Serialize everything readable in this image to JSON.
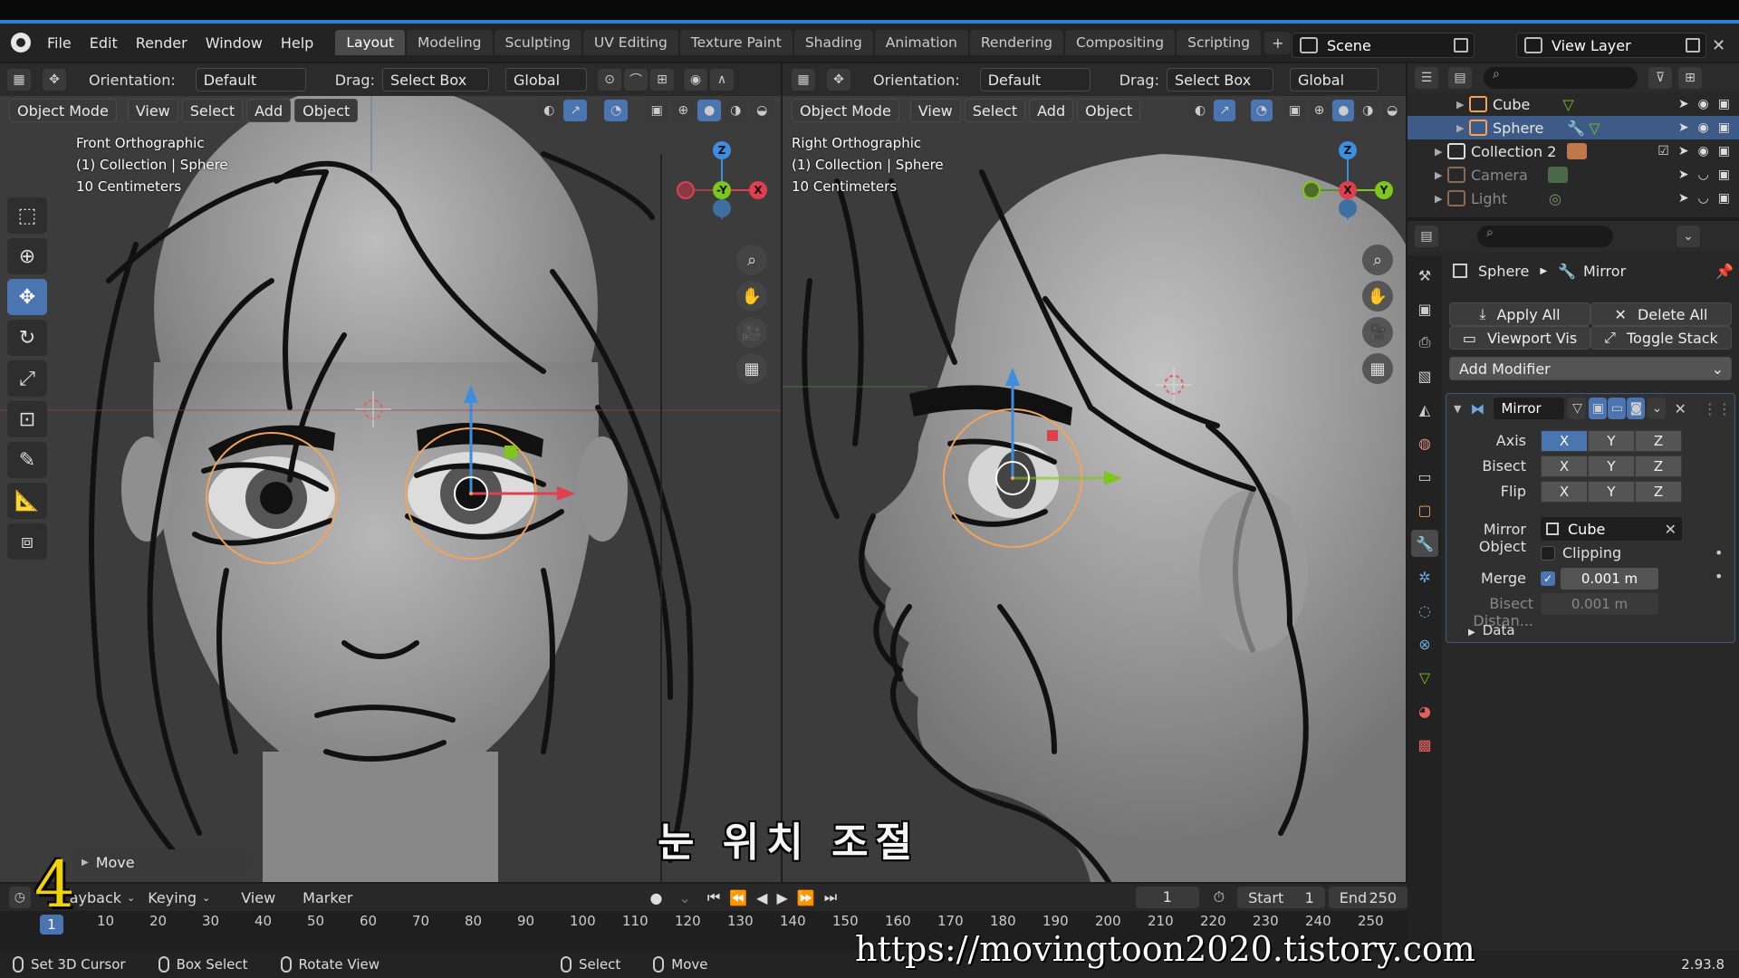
{
  "menubar": {
    "menus": [
      "File",
      "Edit",
      "Render",
      "Window",
      "Help"
    ],
    "workspaces": [
      "Layout",
      "Modeling",
      "Sculpting",
      "UV Editing",
      "Texture Paint",
      "Shading",
      "Animation",
      "Rendering",
      "Compositing",
      "Scripting"
    ],
    "active_workspace": "Layout",
    "add_tab": "+",
    "scene": "Scene",
    "view_layer": "View Layer"
  },
  "viewport_left": {
    "orientation_label": "Orientation:",
    "orientation_value": "Default",
    "drag_label": "Drag:",
    "drag_value": "Select Box",
    "transform_value": "Global",
    "mode": "Object Mode",
    "menus": [
      "View",
      "Select",
      "Add",
      "Object"
    ],
    "overlay": [
      "Front Orthographic",
      "(1) Collection | Sphere",
      "10 Centimeters"
    ]
  },
  "viewport_right": {
    "orientation_label": "Orientation:",
    "orientation_value": "Default",
    "drag_label": "Drag:",
    "drag_value": "Select Box",
    "transform_value": "Global",
    "mode": "Object Mode",
    "menus": [
      "View",
      "Select",
      "Add",
      "Object"
    ],
    "overlay": [
      "Right Orthographic",
      "(1) Collection | Sphere",
      "10 Centimeters"
    ]
  },
  "gizmo_left": {
    "top": "Z",
    "center": "-Y",
    "right": "X"
  },
  "gizmo_right": {
    "top": "Z",
    "center": "X",
    "right": "Y"
  },
  "operator_panel": "Move",
  "subtitle": "눈 위치 조절",
  "step_number": "4",
  "watermark": "https://movingtoon2020.tistory.com",
  "outliner": {
    "items": [
      {
        "name": "Cube",
        "selected": false,
        "dim": false
      },
      {
        "name": "Sphere",
        "selected": true,
        "dim": false
      },
      {
        "name": "Collection 2",
        "selected": false,
        "dim": false
      },
      {
        "name": "Camera",
        "selected": false,
        "dim": true
      },
      {
        "name": "Light",
        "selected": false,
        "dim": true
      }
    ]
  },
  "properties": {
    "breadcrumb_object": "Sphere",
    "breadcrumb_modifier": "Mirror",
    "apply_all": "Apply All",
    "delete_all": "Delete All",
    "viewport_vis": "Viewport Vis",
    "toggle_stack": "Toggle Stack",
    "add_modifier": "Add Modifier",
    "modifier_name": "Mirror",
    "axis_label": "Axis",
    "bisect_label": "Bisect",
    "flip_label": "Flip",
    "xyz": [
      "X",
      "Y",
      "Z"
    ],
    "mirror_object_label": "Mirror Object",
    "mirror_object_value": "Cube",
    "clipping_label": "Clipping",
    "clipping_checked": false,
    "merge_label": "Merge",
    "merge_checked": true,
    "merge_value": "0.001 m",
    "bisect_distance_label": "Bisect Distan...",
    "bisect_distance_value": "0.001 m",
    "data_label": "Data"
  },
  "timeline": {
    "playback": "ayback",
    "keying": "Keying",
    "view": "View",
    "marker": "Marker",
    "current_frame": "1",
    "start_label": "Start",
    "start_value": "1",
    "end_label": "End",
    "end_value": "250",
    "ticks": [
      "1",
      "10",
      "20",
      "30",
      "40",
      "50",
      "60",
      "70",
      "80",
      "90",
      "100",
      "110",
      "120",
      "130",
      "140",
      "150",
      "160",
      "170",
      "180",
      "190",
      "200",
      "210",
      "220",
      "230",
      "240",
      "250"
    ]
  },
  "statusbar": {
    "items": [
      "Set 3D Cursor",
      "Box Select",
      "Rotate View",
      "Select",
      "Move"
    ],
    "version": "2.93.8"
  },
  "colors": {
    "accent": "#4b75b0",
    "selection_orange": "#f2a55a",
    "axis_x": "#e0404e",
    "axis_y": "#7ec51c",
    "axis_z": "#3d8de0"
  }
}
